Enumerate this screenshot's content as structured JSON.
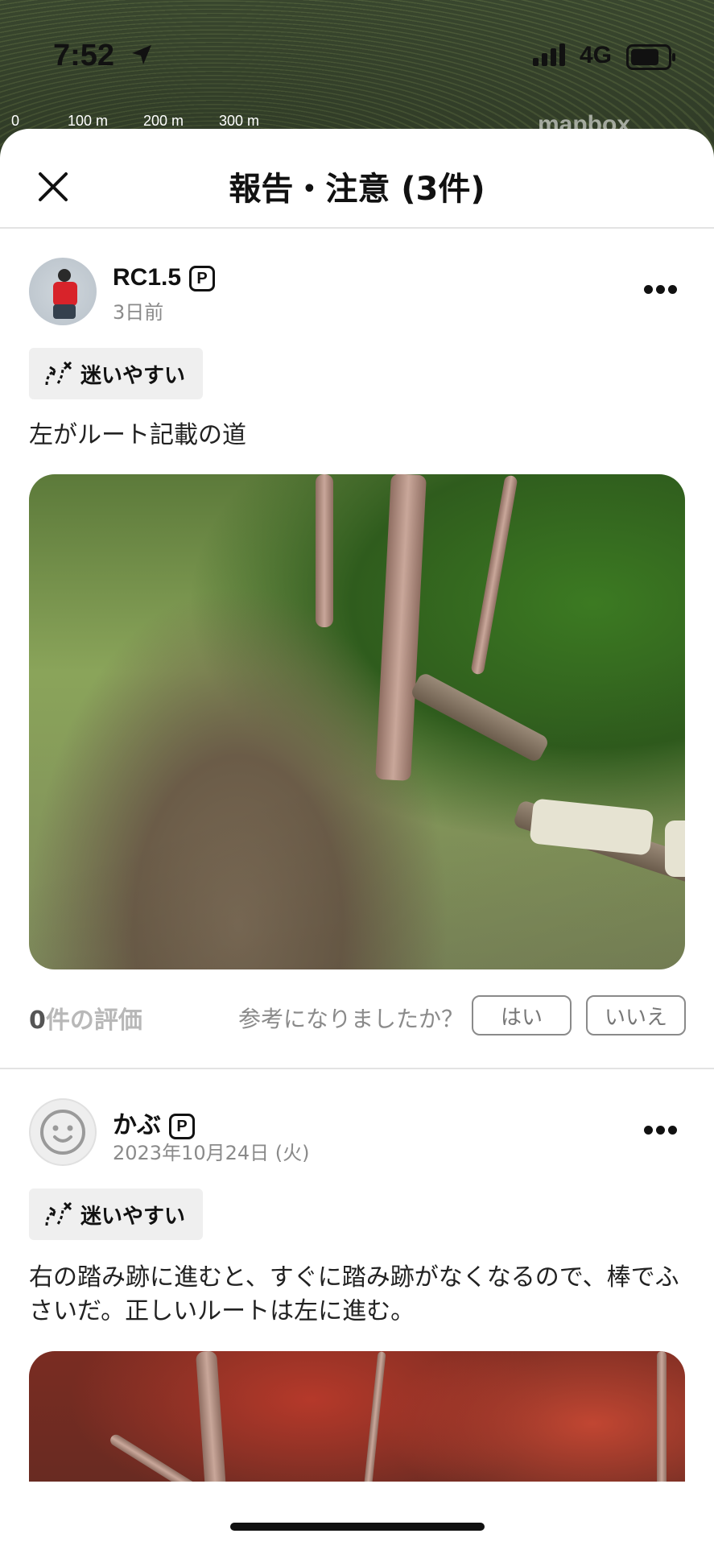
{
  "status_bar": {
    "time": "7:52",
    "network": "4G"
  },
  "map": {
    "scale_labels": [
      "0",
      "100 m",
      "200 m",
      "300 m"
    ],
    "attribution": "mapbox"
  },
  "sheet": {
    "title": "報告・注意 (3件)"
  },
  "reports": [
    {
      "username": "RC1.5",
      "badge": "P",
      "posted": "3日前",
      "tag": "迷いやすい",
      "text": "左がルート記載の道",
      "rating_count": "0",
      "rating_suffix": "件の評価",
      "helpful_question": "参考になりましたか？",
      "yes_label": "はい",
      "no_label": "いいえ"
    },
    {
      "username": "かぶ",
      "badge": "P",
      "posted": "2023年10月24日 (火)",
      "tag": "迷いやすい",
      "text": "右の踏み跡に進むと、すぐに踏み跡がなくなるので、棒でふさいだ。正しいルートは左に進む。"
    }
  ],
  "icons": {
    "close": "close-icon",
    "more": "more-icon",
    "lost": "lost-route-icon",
    "location": "location-arrow-icon"
  }
}
